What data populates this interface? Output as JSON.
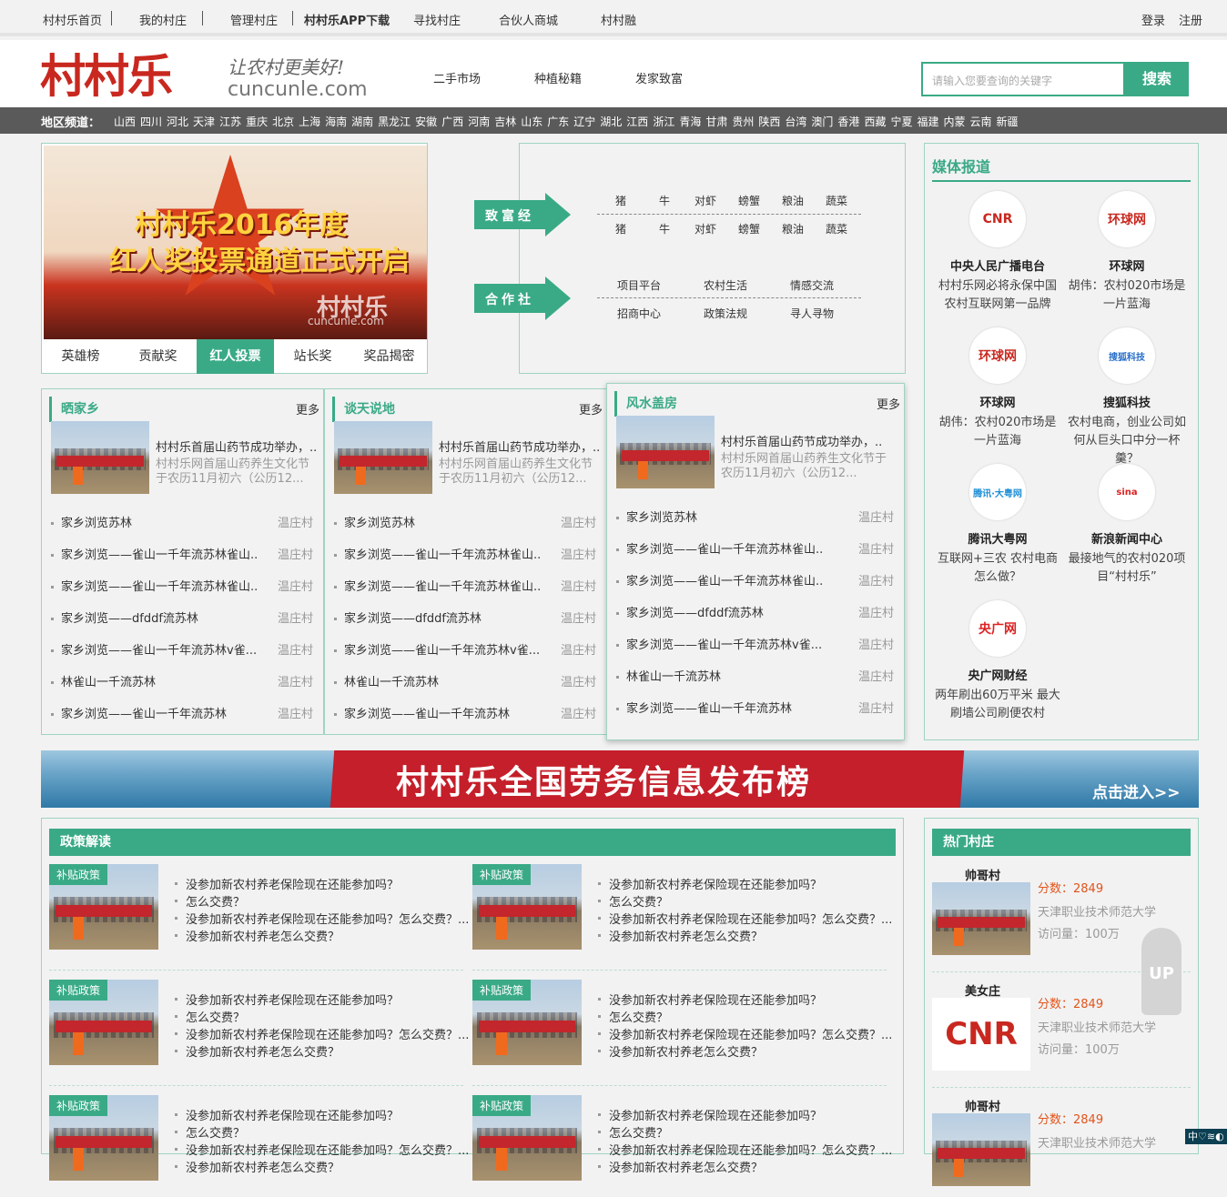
{
  "topbar": {
    "home": "村村乐首页",
    "my_village": "我的村庄",
    "manage": "管理村庄",
    "app": "村村乐APP下载",
    "find": "寻找村庄",
    "mall": "合伙人商城",
    "rong": "村村融",
    "login": "登录",
    "register": "注册"
  },
  "header": {
    "logo": "村村乐",
    "slogan": "让农村更美好!",
    "domain": "cuncunle.com",
    "nav": [
      "二手市场",
      "种植秘籍",
      "发家致富"
    ],
    "search_placeholder": "请输入您要查询的关键字",
    "search_btn": "搜索"
  },
  "region": {
    "label": "地区频道：",
    "items": [
      "山西",
      "四川",
      "河北",
      "天津",
      "江苏",
      "重庆",
      "北京",
      "上海",
      "海南",
      "湖南",
      "黑龙江",
      "安徽",
      "广西",
      "河南",
      "吉林",
      "山东",
      "广东",
      "辽宁",
      "湖北",
      "江西",
      "浙江",
      "青海",
      "甘肃",
      "贵州",
      "陕西",
      "台湾",
      "澳门",
      "香港",
      "西藏",
      "宁夏",
      "福建",
      "内蒙",
      "云南",
      "新疆"
    ]
  },
  "banner": {
    "line1": "村村乐2016年度",
    "line2": "红人奖投票通道正式开启",
    "wm": "村村乐",
    "wm2": "cuncunle.com",
    "tabs": [
      "英雄榜",
      "贡献奖",
      "红人投票",
      "站长奖",
      "奖品揭密"
    ]
  },
  "mid": {
    "zhifu": "致富经",
    "hezuo": "合作社",
    "row1": [
      "猪",
      "牛",
      "对虾",
      "螃蟹",
      "粮油",
      "蔬菜"
    ],
    "row2": [
      "猪",
      "牛",
      "对虾",
      "螃蟹",
      "粮油",
      "蔬菜"
    ],
    "row3": [
      "项目平台",
      "农村生活",
      "情感交流"
    ],
    "row4": [
      "招商中心",
      "政策法规",
      "寻人寻物"
    ]
  },
  "media": {
    "title": "媒体报道",
    "items": [
      {
        "logo": "CNR",
        "name": "中央人民广播电台",
        "desc": "村村乐网必将永保中国农村互联网第一品牌"
      },
      {
        "logo": "环球网",
        "name": "环球网",
        "desc": "胡伟：农村020市场是一片蓝海"
      },
      {
        "logo": "环球网",
        "name": "环球网",
        "desc": "胡伟：农村020市场是一片蓝海"
      },
      {
        "logo": "搜狐科技",
        "name": "搜狐科技",
        "desc": "农村电商，创业公司如何从巨头口中分一杯羹？"
      },
      {
        "logo": "腾讯·大粤网",
        "name": "腾讯大粤网",
        "desc": "互联网+三农 农村电商怎么做？"
      },
      {
        "logo": "sina",
        "name": "新浪新闻中心",
        "desc": "最接地气的农村020项目“村村乐”"
      },
      {
        "logo": "央广网",
        "name": "央广网财经",
        "desc": "两年刷出60万平米 最大刷墙公司刷便农村"
      }
    ]
  },
  "cols": [
    {
      "title": "晒家乡",
      "more": "更多",
      "headline": "村村乐首届山药节成功举办，..",
      "sub": "村村乐网首届山药养生文化节于农历11月初六（公历12...",
      "list": [
        "家乡浏览苏林",
        "家乡浏览——雀山一千年流苏林雀山..",
        "家乡浏览——雀山一千年流苏林雀山..",
        "家乡浏览——dfddf流苏林",
        "家乡浏览——雀山一千年流苏林v雀...",
        "林雀山一千流苏林",
        "家乡浏览——雀山一千年流苏林"
      ],
      "village": "温庄村"
    },
    {
      "title": "谈天说地",
      "more": "更多",
      "headline": "村村乐首届山药节成功举办，..",
      "sub": "村村乐网首届山药养生文化节于农历11月初六（公历12...",
      "list": [
        "家乡浏览苏林",
        "家乡浏览——雀山一千年流苏林雀山..",
        "家乡浏览——雀山一千年流苏林雀山..",
        "家乡浏览——dfddf流苏林",
        "家乡浏览——雀山一千年流苏林v雀...",
        "林雀山一千流苏林",
        "家乡浏览——雀山一千年流苏林"
      ],
      "village": "温庄村"
    },
    {
      "title": "风水盖房",
      "more": "更多",
      "headline": "村村乐首届山药节成功举办，..",
      "sub": "村村乐网首届山药养生文化节于农历11月初六（公历12...",
      "list": [
        "家乡浏览苏林",
        "家乡浏览——雀山一千年流苏林雀山..",
        "家乡浏览——雀山一千年流苏林雀山..",
        "家乡浏览——dfddf流苏林",
        "家乡浏览——雀山一千年流苏林v雀...",
        "林雀山一千流苏林",
        "家乡浏览——雀山一千年流苏林"
      ],
      "village": "温庄村"
    }
  ],
  "ad": {
    "text": "村村乐全国劳务信息发布榜",
    "enter": "点击进入>>"
  },
  "policy": {
    "title": "政策解读",
    "tag": "补贴政策",
    "q1": "没参加新农村养老保险现在还能参加吗？",
    "q2": "怎么交费？",
    "q3": "没参加新农村养老保险现在还能参加吗？怎么交费？...",
    "q4": "没参加新农村养老怎么交费？"
  },
  "hot": {
    "title": "热门村庄",
    "items": [
      {
        "name": "帅哥村",
        "score": "分数：2849",
        "school": "天津职业技术师范大学",
        "visits": "访问量：100万"
      },
      {
        "name": "美女庄",
        "score": "分数：2849",
        "school": "天津职业技术师范大学",
        "visits": "访问量：100万"
      },
      {
        "name": "帅哥村",
        "score": "分数：2849",
        "school": "天津职业技术师范大学",
        "visits": ""
      }
    ]
  },
  "up": "UP",
  "corner": "中♡≋◐"
}
